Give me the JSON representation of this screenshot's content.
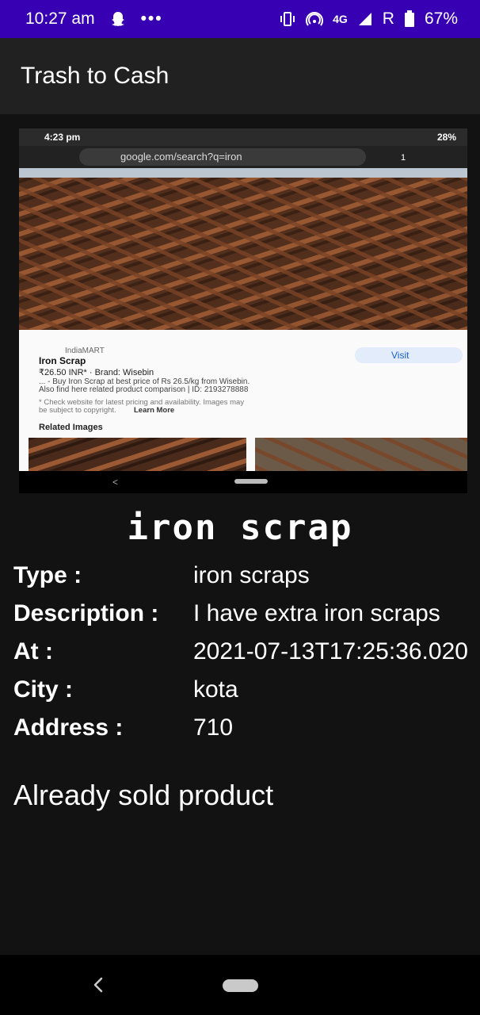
{
  "status_bar": {
    "time": "10:27 am",
    "dots": "•••",
    "network": "4G",
    "roaming": "R",
    "battery": "67%"
  },
  "app_bar": {
    "title": "Trash to Cash"
  },
  "product_image": {
    "status_time": "4:23 pm",
    "status_battery": "28%",
    "url": "google.com/search?q=iron",
    "tab_count": "1",
    "source": "IndiaMART",
    "item_title": "Iron Scrap",
    "price_line": "₹26.50 INR* · Brand: Wisebin",
    "visit_label": "Visit",
    "desc_line1": "... - Buy Iron Scrap at best price of Rs 26.5/kg from Wisebin.",
    "desc_line2": "Also find here related product comparison | ID: 2193278888",
    "note_line1": "* Check website for latest pricing and availability. Images may",
    "note_line2": "be subject to copyright.",
    "learn_more": "Learn More",
    "related_heading": "Related Images",
    "nav_back": "<"
  },
  "product": {
    "name": "iron scrap",
    "type_label": "Type :",
    "type_value": "iron scraps",
    "description_label": "Description :",
    "description_value": "I have extra iron scraps",
    "at_label": "At :",
    "at_value": "2021-07-13T17:25:36.020",
    "city_label": "City :",
    "city_value": "kota",
    "address_label": "Address :",
    "address_value": "710",
    "sold_status": "Already sold product"
  },
  "colors": {
    "status_bar": "#3700b3",
    "app_bar": "#212121",
    "background": "#121212"
  }
}
